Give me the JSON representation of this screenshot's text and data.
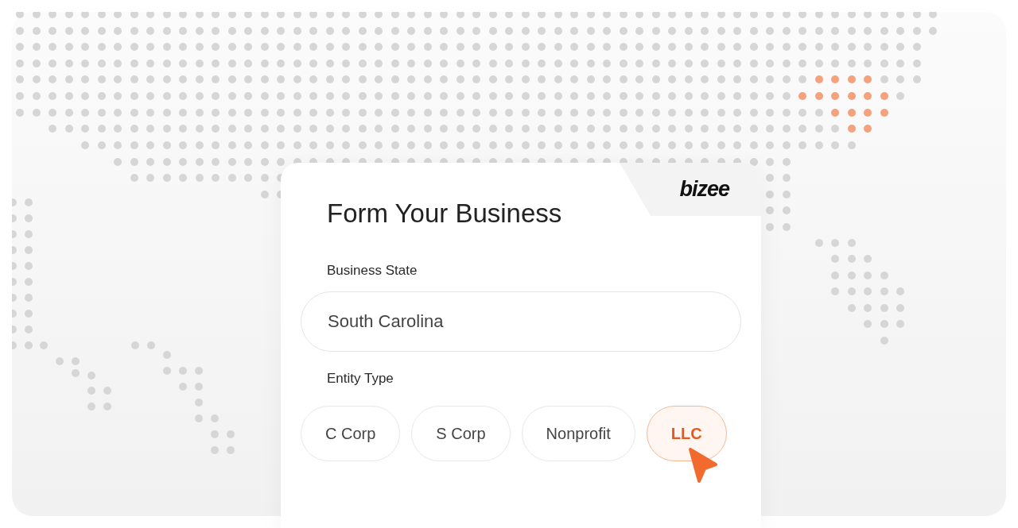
{
  "brand": {
    "logo": "bizee"
  },
  "title": "Form Your Business",
  "fields": [
    {
      "label": "Business State",
      "value": "South Carolina"
    }
  ],
  "entity": {
    "label": "Entity Type",
    "options": [
      {
        "label": "C Corp",
        "selected": false
      },
      {
        "label": "S Corp",
        "selected": false
      },
      {
        "label": "Nonprofit",
        "selected": false
      },
      {
        "label": "LLC",
        "selected": true
      }
    ]
  }
}
